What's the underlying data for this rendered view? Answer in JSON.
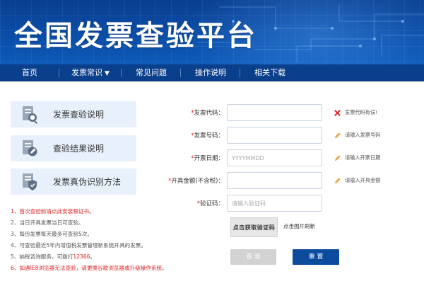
{
  "header": {
    "title": "全国发票查验平台"
  },
  "nav": {
    "items": [
      {
        "label": "首页"
      },
      {
        "label": "发票常识",
        "chevron": "chevron-down-icon"
      },
      {
        "label": "常见问题"
      },
      {
        "label": "操作说明"
      },
      {
        "label": "相关下载"
      }
    ]
  },
  "sidebar": {
    "cards": [
      {
        "label": "发票查验说明",
        "icon": "document-search-icon"
      },
      {
        "label": "查验结果说明",
        "icon": "document-edit-icon"
      },
      {
        "label": "发票真伪识别方法",
        "icon": "document-shield-icon"
      }
    ]
  },
  "notes": {
    "n1": "1、首次查验前请点此安装根证书。",
    "n2": "2、当日开具发票当日可查验。",
    "n3": "3、每份发票每天最多可查验5次。",
    "n4": "4、可查验最近5年内增值税发票管理新系统开具的发票。",
    "n5_prefix": "5、纳税咨询服务，可拨打",
    "n5_phone": "12366",
    "n5_suffix": "。",
    "n6": "6、如遇IE8浏览器无法查验，请更换谷歌浏览器或升级操作系统。"
  },
  "form": {
    "code": {
      "label": "发票代码：",
      "value": "",
      "placeholder": "",
      "hint": "发票代码有误!"
    },
    "number": {
      "label": "发票号码：",
      "value": "",
      "placeholder": "",
      "hint": "请输入发票号码"
    },
    "date": {
      "label": "开票日期：",
      "value": "",
      "placeholder": "YYYYMMDD",
      "hint": "请输入开票日期"
    },
    "amount": {
      "label": "开具金额(不含税)：",
      "value": "",
      "placeholder": "",
      "hint": "请输入开具金额"
    },
    "captcha": {
      "label": "验证码：",
      "value": "",
      "placeholder": "请输入验证码"
    },
    "captcha_image_text": "点击获取验证码",
    "captcha_refresh": "点击图片刷新",
    "query_label": "查 验",
    "reset_label": "重 置"
  },
  "colors": {
    "primary": "#0a4b9e",
    "nav_bg": "#0a3f8c",
    "error": "#e02020",
    "card_bg": "#e8f1fb"
  }
}
